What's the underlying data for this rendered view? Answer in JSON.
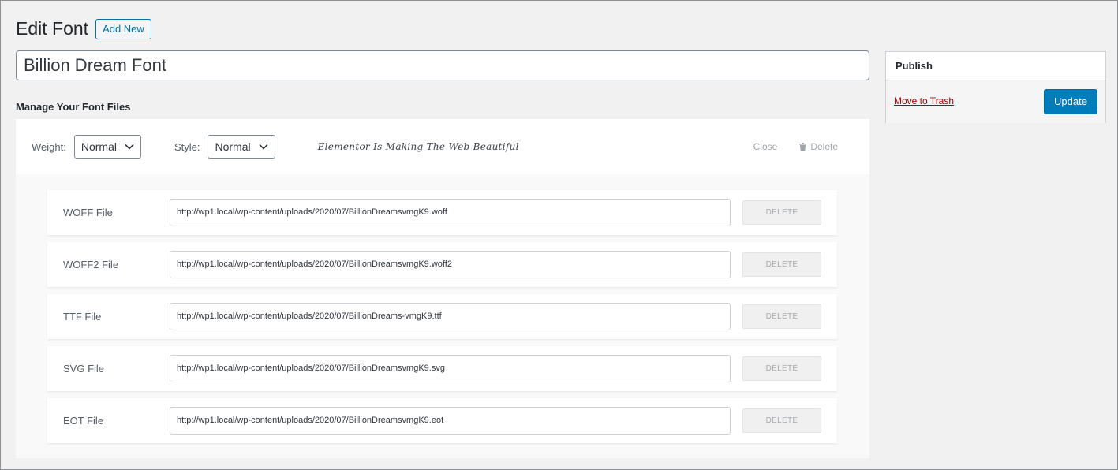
{
  "header": {
    "title": "Edit Font",
    "add_new_label": "Add New"
  },
  "post_title": {
    "value": "Billion Dream Font"
  },
  "section": {
    "label": "Manage Your Font Files"
  },
  "variation": {
    "weight_label": "Weight:",
    "weight_value": "Normal",
    "style_label": "Style:",
    "style_value": "Normal",
    "preview_text": "Elementor Is Making The Web Beautiful",
    "close_label": "Close",
    "delete_label": "Delete"
  },
  "files": [
    {
      "label": "WOFF File",
      "url": "http://wp1.local/wp-content/uploads/2020/07/BillionDreamsvmgK9.woff",
      "delete_label": "DELETE"
    },
    {
      "label": "WOFF2 File",
      "url": "http://wp1.local/wp-content/uploads/2020/07/BillionDreamsvmgK9.woff2",
      "delete_label": "DELETE"
    },
    {
      "label": "TTF File",
      "url": "http://wp1.local/wp-content/uploads/2020/07/BillionDreams-vmgK9.ttf",
      "delete_label": "DELETE"
    },
    {
      "label": "SVG File",
      "url": "http://wp1.local/wp-content/uploads/2020/07/BillionDreamsvmgK9.svg",
      "delete_label": "DELETE"
    },
    {
      "label": "EOT File",
      "url": "http://wp1.local/wp-content/uploads/2020/07/BillionDreamsvmgK9.eot",
      "delete_label": "DELETE"
    }
  ],
  "publish": {
    "title": "Publish",
    "trash_label": "Move to Trash",
    "update_label": "Update"
  },
  "colors": {
    "primary_button": "#007cba",
    "trash_link": "#aa0000",
    "add_new_border": "#0071a1"
  },
  "icons": [
    "chevron-down-icon",
    "trash-icon"
  ]
}
